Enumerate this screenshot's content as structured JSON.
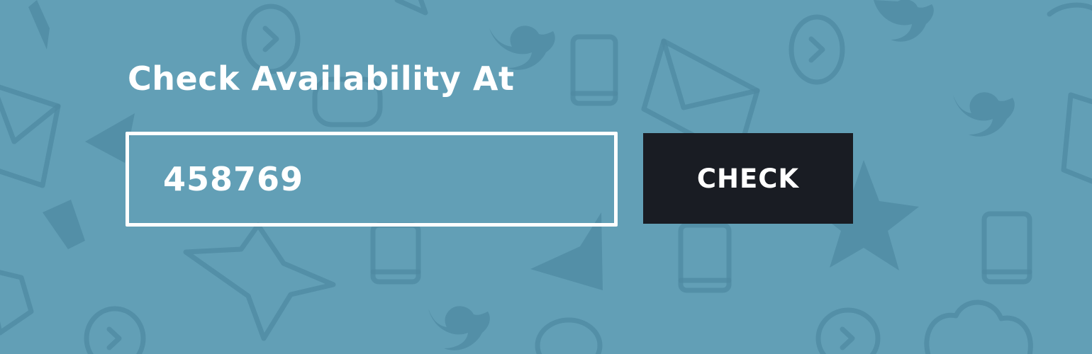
{
  "colors": {
    "background": "#629fb6",
    "pattern": "#4f8aa2",
    "text": "#ffffff",
    "button_background": "#191c23"
  },
  "background_icons": [
    "play-circle-icon",
    "twitter-bird-icon",
    "phone-icon",
    "envelope-icon",
    "star-icon",
    "cloud-icon"
  ],
  "availability": {
    "title": "Check Availability At",
    "input_value": "458769",
    "button_label": "CHECK"
  }
}
